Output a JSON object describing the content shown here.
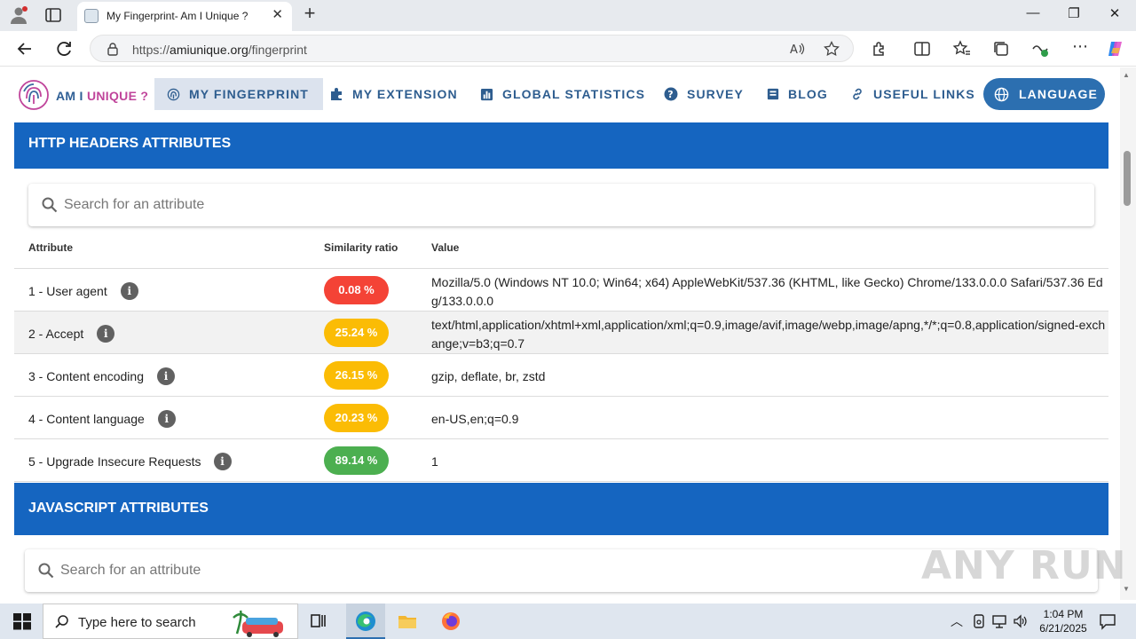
{
  "browser": {
    "tab_title": "My Fingerprint- Am I Unique ?",
    "url_prefix": "https://",
    "url_domain": "amiunique.org",
    "url_path": "/fingerprint"
  },
  "site": {
    "logo_text_main": "AM I",
    "logo_text_accent": "UNIQUE ?",
    "nav": [
      {
        "label": "MY FINGERPRINT",
        "icon": "fingerprint-icon"
      },
      {
        "label": "MY EXTENSION",
        "icon": "puzzle-icon"
      },
      {
        "label": "GLOBAL STATISTICS",
        "icon": "bar-chart-icon"
      },
      {
        "label": "SURVEY",
        "icon": "help-circle-icon"
      },
      {
        "label": "BLOG",
        "icon": "blog-icon"
      },
      {
        "label": "USEFUL LINKS",
        "icon": "link-icon"
      }
    ],
    "language_label": "LANGUAGE"
  },
  "http_section": {
    "title": "HTTP HEADERS ATTRIBUTES",
    "search_placeholder": "Search for an attribute",
    "columns": {
      "attribute": "Attribute",
      "similarity": "Similarity ratio",
      "value": "Value"
    },
    "rows": [
      {
        "attribute": "1 - User agent",
        "ratio": "0.08 %",
        "ratio_color": "#f44336",
        "value": "Mozilla/5.0 (Windows NT 10.0; Win64; x64) AppleWebKit/537.36 (KHTML, like Gecko) Chrome/133.0.0.0 Safari/537.36 Edg/133.0.0.0"
      },
      {
        "attribute": "2 - Accept",
        "ratio": "25.24 %",
        "ratio_color": "#fbbc05",
        "value": "text/html,application/xhtml+xml,application/xml;q=0.9,image/avif,image/webp,image/apng,*/*;q=0.8,application/signed-exchange;v=b3;q=0.7"
      },
      {
        "attribute": "3 - Content encoding",
        "ratio": "26.15 %",
        "ratio_color": "#fbbc05",
        "value": "gzip, deflate, br, zstd"
      },
      {
        "attribute": "4 - Content language",
        "ratio": "20.23 %",
        "ratio_color": "#fbbc05",
        "value": "en-US,en;q=0.9"
      },
      {
        "attribute": "5 - Upgrade Insecure Requests",
        "ratio": "89.14 %",
        "ratio_color": "#4caf50",
        "value": "1"
      }
    ]
  },
  "js_section": {
    "title": "JAVASCRIPT ATTRIBUTES",
    "search_placeholder": "Search for an attribute"
  },
  "watermark": "ANY RUN",
  "taskbar": {
    "search_placeholder": "Type here to search",
    "time": "1:04 PM",
    "date": "6/21/2025"
  },
  "colors": {
    "section_header": "#1565c0",
    "nav_text": "#2e5d8f",
    "language_button": "#2c6fb0",
    "logo_accent": "#c0459b"
  }
}
